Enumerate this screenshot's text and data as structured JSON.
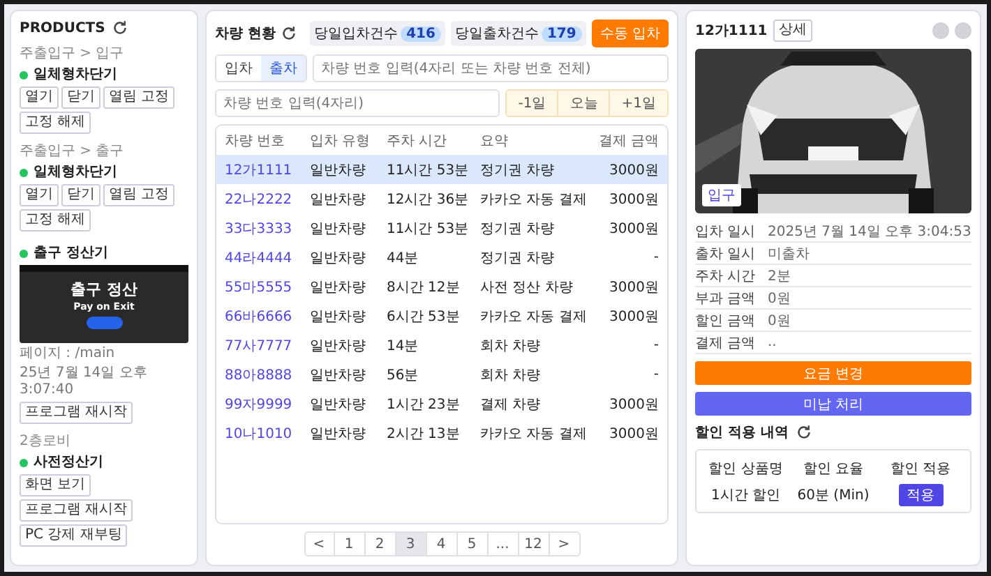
{
  "left_panel": {
    "title": "PRODUCTS",
    "devices": [
      {
        "kind": "gate",
        "location": "주출입구 > 입구",
        "name": "일체형차단기",
        "color": "#22c55e",
        "buttons": [
          "열기",
          "닫기",
          "열림 고정",
          "고정 해제"
        ]
      },
      {
        "kind": "gate",
        "location": "주출입구 > 출구",
        "name": "일체형차단기",
        "color": "#22c55e",
        "buttons": [
          "열기",
          "닫기",
          "열림 고정",
          "고정 해제"
        ]
      },
      {
        "kind": "kiosk",
        "name": "출구 정산기",
        "color": "#22c55e",
        "preview": {
          "heading": "출구 정산",
          "subheading": "Pay on Exit"
        },
        "page": "페이지 : /main",
        "timestamp": "25년 7월 14일 오후 3:07:40",
        "buttons": [
          "프로그램 재시작"
        ]
      },
      {
        "kind": "gate",
        "location": "2층로비",
        "name": "사전정산기",
        "color": "#22c55e",
        "buttons": [
          "화면 보기",
          "프로그램 재시작",
          "PC 강제 재부팅"
        ]
      }
    ]
  },
  "vehicles": {
    "title": "차량 현황",
    "counters": [
      {
        "label": "당일입차건수",
        "count": "416"
      },
      {
        "label": "당일출차건수",
        "count": "179"
      }
    ],
    "action": "수동 입차",
    "tabs": [
      {
        "label": "입차",
        "selected": false
      },
      {
        "label": "출차",
        "selected": true
      }
    ],
    "search_placeholder": "차량 번호 입력(4자리 또는 차량 번호 전체)",
    "plate_placeholder": "차량 번호 입력(4자리)",
    "day_buttons": [
      "-1일",
      "오늘",
      "+1일"
    ],
    "columns": [
      "차량 번호",
      "입차 유형",
      "주차 시간",
      "요약",
      "결제 금액"
    ],
    "rows": [
      {
        "plate": "12가1111",
        "type": "일반차량",
        "duration": "11시간 53분",
        "summary": "정기권 차량",
        "amount": "3000원",
        "selected": true
      },
      {
        "plate": "22나2222",
        "type": "일반차량",
        "duration": "12시간 36분",
        "summary": "카카오 자동 결제",
        "amount": "3000원",
        "selected": false
      },
      {
        "plate": "33다3333",
        "type": "일반차량",
        "duration": "11시간 53분",
        "summary": "정기권 차량",
        "amount": "3000원",
        "selected": false
      },
      {
        "plate": "44라4444",
        "type": "일반차량",
        "duration": "44분",
        "summary": "정기권 차량",
        "amount": "-",
        "selected": false
      },
      {
        "plate": "55마5555",
        "type": "일반차량",
        "duration": "8시간 12분",
        "summary": "사전 정산 차량",
        "amount": "3000원",
        "selected": false
      },
      {
        "plate": "66바6666",
        "type": "일반차량",
        "duration": "6시간 53분",
        "summary": "카카오 자동 결제",
        "amount": "3000원",
        "selected": false
      },
      {
        "plate": "77사7777",
        "type": "일반차량",
        "duration": "14분",
        "summary": "회차 차량",
        "amount": "-",
        "selected": false
      },
      {
        "plate": "88아8888",
        "type": "일반차량",
        "duration": "56분",
        "summary": "회차 차량",
        "amount": "-",
        "selected": false
      },
      {
        "plate": "99자9999",
        "type": "일반차량",
        "duration": "1시간 23분",
        "summary": "결제 차량",
        "amount": "3000원",
        "selected": false
      },
      {
        "plate": "10나1010",
        "type": "일반차량",
        "duration": "2시간 13분",
        "summary": "카카오 자동 결제",
        "amount": "3000원",
        "selected": false
      }
    ],
    "pages": [
      {
        "label": "<",
        "selected": false
      },
      {
        "label": "1",
        "selected": false
      },
      {
        "label": "2",
        "selected": false
      },
      {
        "label": "3",
        "selected": true
      },
      {
        "label": "4",
        "selected": false
      },
      {
        "label": "5",
        "selected": false
      },
      {
        "label": "...",
        "selected": false
      },
      {
        "label": "12",
        "selected": false
      },
      {
        "label": ">",
        "selected": false
      }
    ]
  },
  "detail": {
    "plate": "12가1111",
    "detail_button": "상세",
    "photo": {
      "kind": "picture",
      "badge": "입구"
    },
    "fields": [
      {
        "label": "입차 일시",
        "value": "2025년 7월 14일 오후 3:04:53"
      },
      {
        "label": "출차 일시",
        "value": "미출차"
      },
      {
        "label": "주차 시간",
        "value": "2분"
      },
      {
        "label": "부과 금액",
        "value": "0원"
      },
      {
        "label": "할인 금액",
        "value": "0원"
      },
      {
        "label": "결제 금액",
        "value": ".."
      }
    ],
    "actions": [
      {
        "label": "요금 변경",
        "kind": "primary"
      },
      {
        "label": "미납 처리",
        "kind": "secondary"
      }
    ],
    "discounts": {
      "title": "할인 적용 내역",
      "columns": [
        "할인 상품명",
        "할인 요율",
        "할인 적용"
      ],
      "rows": [
        {
          "name": "1시간 할인",
          "rate": "60분 (Min)",
          "action": "적용"
        }
      ]
    }
  }
}
